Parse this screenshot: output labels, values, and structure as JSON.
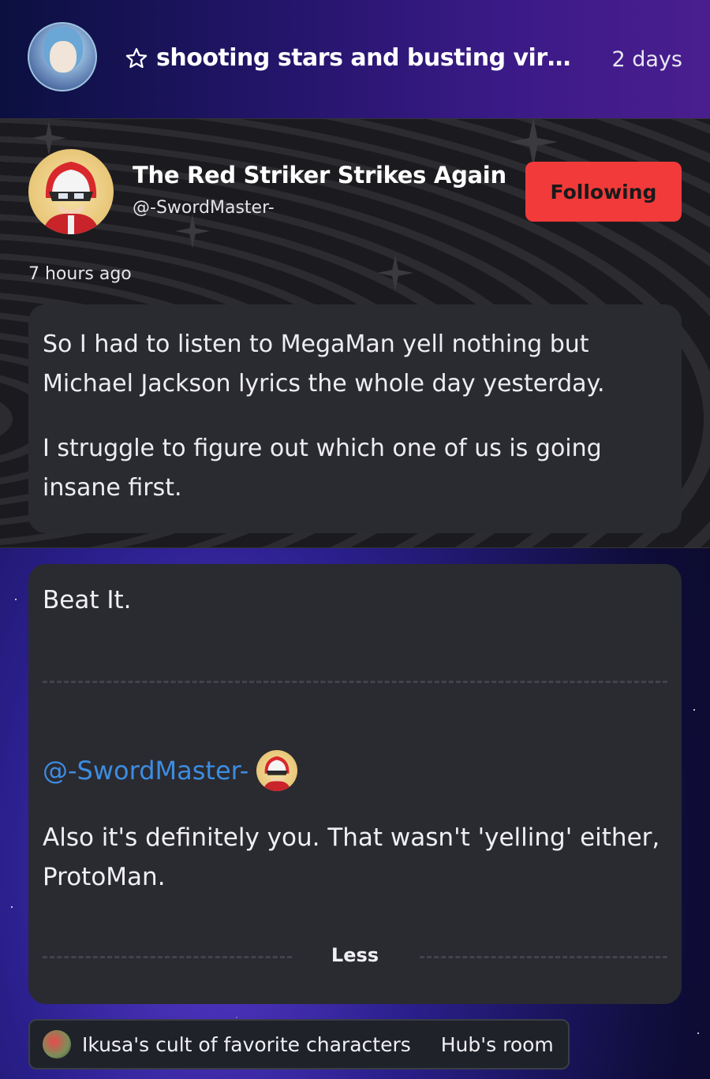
{
  "header": {
    "title": "shooting stars and busting viruse...",
    "time": "2 days",
    "star_icon": "star-outline-icon"
  },
  "post": {
    "author_name": "The Red Striker Strikes Again",
    "author_handle": "@-SwordMaster-",
    "follow_label": "Following",
    "posted": "7 hours ago",
    "paragraphs": [
      "So I had to listen to MegaMan yell nothing but Michael Jackson lyrics the whole day yesterday.",
      "I struggle to figure out which one of us is going insane first."
    ]
  },
  "comment": {
    "lead": "Beat It.",
    "mention": "@-SwordMaster-",
    "body": "Also it's definitely you. That wasn't 'yelling' either, ProtoMan.",
    "less_label": "Less"
  },
  "chat": {
    "name": "Ikusa's cult of favorite characters",
    "room": "Hub's room"
  },
  "colors": {
    "follow_button": "#f23a3a",
    "mention_link": "#3d8de0",
    "card_bg": "#2a2a31"
  }
}
